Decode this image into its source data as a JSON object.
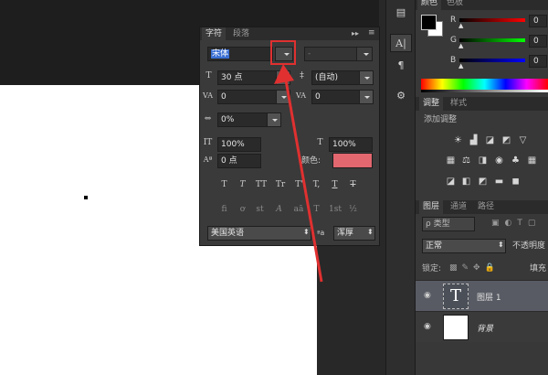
{
  "char_panel": {
    "tabs": [
      "字符",
      "段落"
    ],
    "font_family": "宋体",
    "font_style": "-",
    "font_size": "30 点",
    "leading": "(自动)",
    "kerning": "0",
    "tracking": "0",
    "scaling": "0%",
    "vertical_scale": "100%",
    "horizontal_scale": "100%",
    "baseline_shift": "0 点",
    "color_label": "颜色:",
    "text_color": "#e2676f",
    "style_buttons": [
      "T",
      "T",
      "TT",
      "Tr",
      "T'",
      "T,",
      "T",
      "T"
    ],
    "opentype_buttons": [
      "fi",
      "ơ",
      "st",
      "A",
      "aā",
      "T",
      "1st",
      "½"
    ],
    "language": "美国英语",
    "aa_label": "a",
    "antialias": "浑厚"
  },
  "right": {
    "color_tabs": [
      "颜色",
      "色板"
    ],
    "rgb": [
      {
        "label": "R",
        "value": "0"
      },
      {
        "label": "G",
        "value": "0"
      },
      {
        "label": "B",
        "value": "0"
      }
    ],
    "adj_tabs": [
      "调整",
      "样式"
    ],
    "adj_title": "添加调整",
    "layer_tabs": [
      "图层",
      "通道",
      "路径"
    ],
    "filter_kind": "ρ 类型",
    "blend_mode": "正常",
    "opacity_label": "不透明度",
    "lock_label": "锁定:",
    "fill_label": "填充",
    "layers": [
      {
        "name": "图层 1",
        "thumb_text": "T"
      },
      {
        "name": "背景"
      }
    ]
  },
  "accent": "#e03030"
}
